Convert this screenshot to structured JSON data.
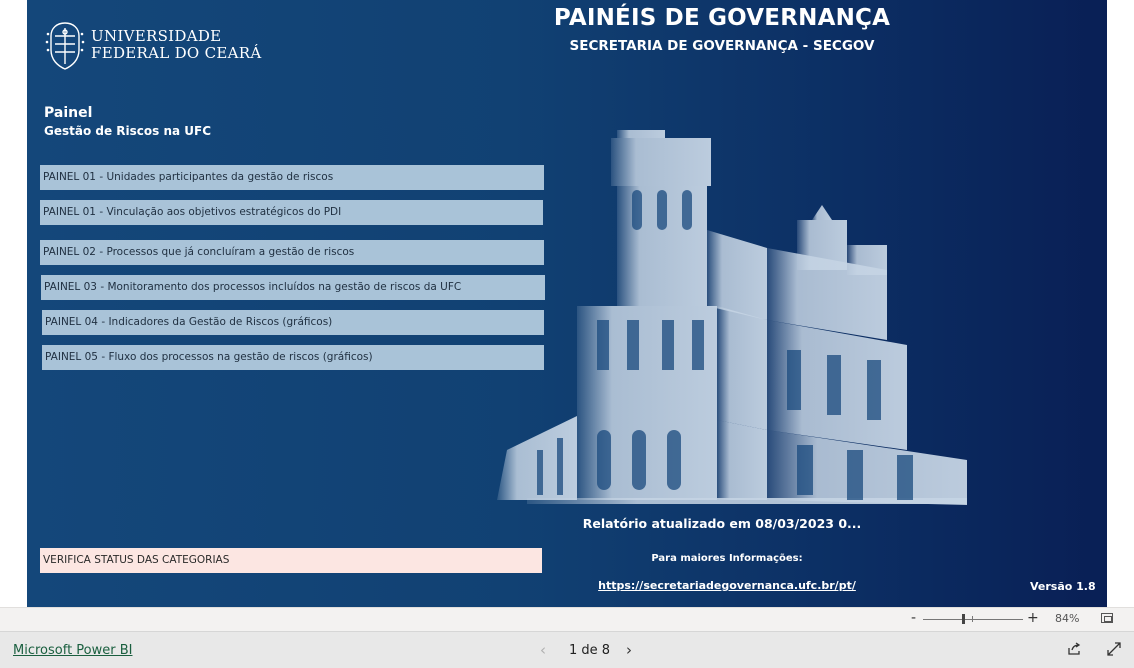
{
  "report": {
    "logo_line1": "UNIVERSIDADE",
    "logo_line2": "FEDERAL DO CEARÁ",
    "title": "PAINÉIS DE GOVERNANÇA",
    "subtitle": "SECRETARIA DE GOVERNANÇA - SECGOV",
    "painel_label": "Painel",
    "painel_subtitle": "Gestão de Riscos na UFC",
    "nav_buttons": [
      "PAINEL 01 - Unidades participantes da gestão de riscos",
      "PAINEL 01 - Vinculação aos objetivos estratégicos do PDI",
      "PAINEL 02 - Processos que já concluíram a gestão de riscos",
      "PAINEL 03 - Monitoramento dos processos incluídos na gestão de riscos da UFC",
      "PAINEL 04 - Indicadores da Gestão de Riscos (gráficos)",
      "PAINEL 05 - Fluxo dos processos na gestão de riscos (gráficos)"
    ],
    "status_button": "VERIFICA STATUS DAS CATEGORIAS",
    "updated_text": "Relatório atualizado em 08/03/2023 0...",
    "more_info": "Para maiores Informações:",
    "info_link": "https://secretariadegovernanca.ufc.br/pt/",
    "version": "Versão 1.8"
  },
  "zoom": {
    "minus": "-",
    "plus": "+",
    "level": "84%"
  },
  "footer": {
    "app_link": "Microsoft Power BI",
    "page_indicator": "1 de 8"
  },
  "colors": {
    "page_background": "#114173",
    "nav_button": "#a9c3d8",
    "status_button": "#fce6e2",
    "building": "#c5d4e4"
  }
}
